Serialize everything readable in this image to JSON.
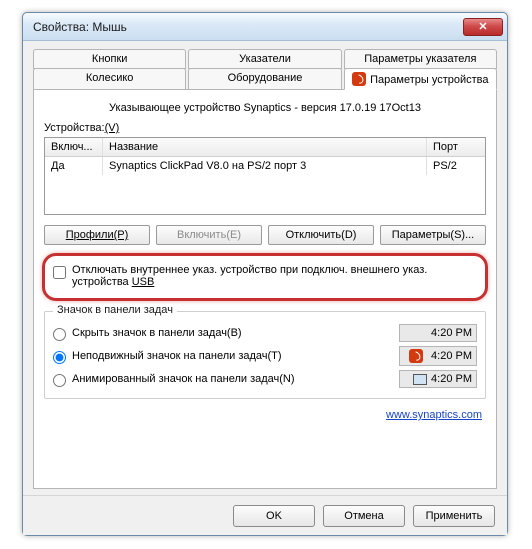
{
  "window": {
    "title": "Свойства: Мышь",
    "close": "✕"
  },
  "tabs": {
    "row1": [
      "Кнопки",
      "Указатели",
      "Параметры указателя"
    ],
    "row2": [
      "Колесико",
      "Оборудование",
      "Параметры устройства"
    ],
    "active_index_row2": 2
  },
  "panel": {
    "title_line": "Указывающее устройство Synaptics - версия 17.0.19 17Oct13",
    "devices_label": "Устройства:",
    "devices_accel": "(V)",
    "headers": {
      "enabled": "Включ...",
      "name": "Название",
      "port": "Порт"
    },
    "rows": [
      {
        "enabled": "Да",
        "name": "Synaptics ClickPad V8.0 на PS/2 порт 3",
        "port": "PS/2"
      }
    ],
    "buttons": {
      "profiles": "Профили(P)",
      "enable": "Включить(E)",
      "disable": "Отключить(D)",
      "settings": "Параметры(S)..."
    },
    "disable_internal": {
      "label_line1": "Отключать внутреннее указ. устройство при подключ. внешнего указ.",
      "label_line2": "устройства ",
      "accel": "USB"
    },
    "tray_group": {
      "title": "Значок в панели задач",
      "opt_hide": "Скрыть значок в панели задач(B)",
      "opt_static": "Неподвижный значок на панели задач(T)",
      "opt_animated": "Анимированный значок на панели задач(N)",
      "sample_time": "4:20 PM",
      "selected_index": 1
    },
    "link": "www.synaptics.com"
  },
  "footer": {
    "ok": "OK",
    "cancel": "Отмена",
    "apply": "Применить"
  }
}
